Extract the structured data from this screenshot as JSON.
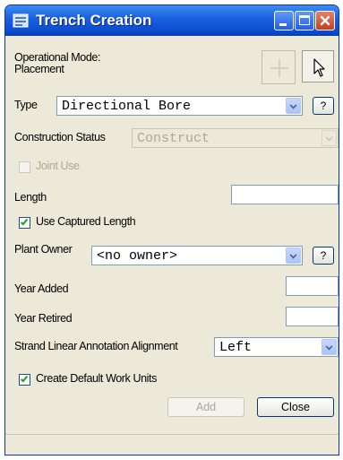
{
  "window": {
    "title": "Trench Creation",
    "title_icon": "app-icon",
    "controls": [
      "minimize-icon",
      "maximize-icon",
      "close-icon"
    ]
  },
  "operational_mode": {
    "label": "Operational Mode:",
    "value": "Placement",
    "tools": [
      "crosshair-icon",
      "pointer-arrow-icon"
    ]
  },
  "type": {
    "label": "Type",
    "value": "Directional Bore",
    "help": "?"
  },
  "construction_status": {
    "label": "Construction Status",
    "value": "Construct"
  },
  "joint_use": {
    "label": "Joint Use",
    "checked": false
  },
  "length": {
    "label": "Length",
    "value": ""
  },
  "use_captured_length": {
    "label": "Use Captured Length",
    "checked": true
  },
  "plant_owner": {
    "label": "Plant Owner",
    "value": "<no owner>",
    "help": "?"
  },
  "year_added": {
    "label": "Year Added",
    "value": ""
  },
  "year_retired": {
    "label": "Year Retired",
    "value": ""
  },
  "strand_alignment": {
    "label": "Strand Linear Annotation Alignment",
    "value": "Left"
  },
  "create_work_units": {
    "label": "Create Default Work Units",
    "checked": true
  },
  "buttons": {
    "add": "Add",
    "close": "Close"
  },
  "colors": {
    "titlebar": "#0a4ccf",
    "accent": "#0831d9",
    "checkmark": "#21a121",
    "close_button": "#c2401f"
  }
}
